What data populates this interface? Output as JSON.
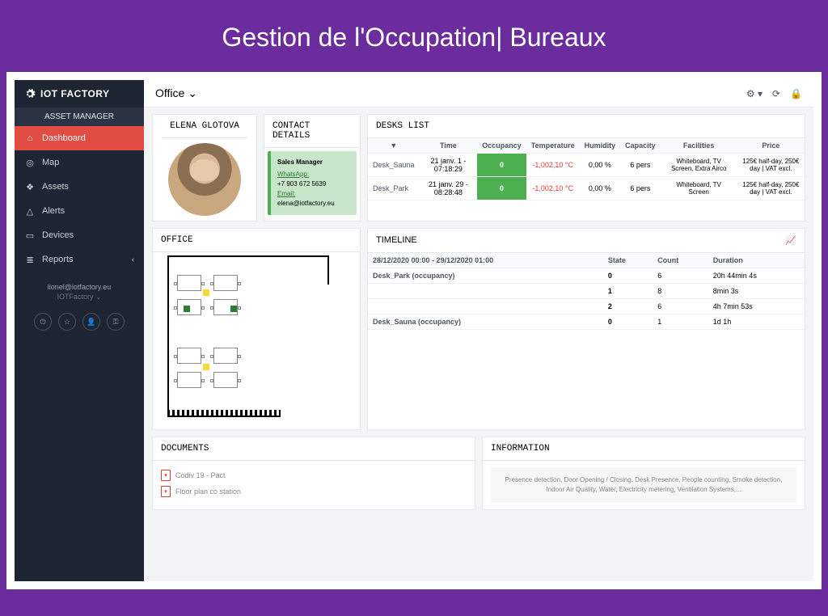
{
  "banner": "Gestion de l'Occupation| Bureaux",
  "brand": "IOT FACTORY",
  "section": "ASSET MANAGER",
  "nav": [
    {
      "label": "Dashboard",
      "active": true
    },
    {
      "label": "Map"
    },
    {
      "label": "Assets"
    },
    {
      "label": "Alerts"
    },
    {
      "label": "Devices"
    },
    {
      "label": "Reports",
      "caret": true
    }
  ],
  "user_email": "lionel@iotfactory.eu",
  "user_sub": "IOTFactory ⌄",
  "page_title": "Office ⌄",
  "profile": {
    "title": "ELENA GLOTOVA"
  },
  "contact": {
    "title": "CONTACT DETAILS",
    "role": "Sales Manager",
    "whatsapp_label": "WhatsApp:",
    "phone": "+7 903 672 5639",
    "email_label": "Email:",
    "email": "elena@iotfactory.eu"
  },
  "desks": {
    "title": "DESKS LIST",
    "headers": [
      "",
      "Time",
      "Occupancy",
      "Temperature",
      "Humidity",
      "Capacity",
      "Facilities",
      "Price"
    ],
    "rows": [
      {
        "name": "Desk_Sauna",
        "time": "21 janv. 1 - 07:18:29",
        "occ": "0",
        "temp": "-1,002,10 °C",
        "hum": "0,00 %",
        "cap": "6 pers",
        "fac": "Whiteboard, TV Screen, Extra Airco",
        "price": "125€ half-day, 250€ day | VAT excl."
      },
      {
        "name": "Desk_Park",
        "time": "21 janv. 29 - 08:28:48",
        "occ": "0",
        "temp": "-1,002,10 °C",
        "hum": "0,00 %",
        "cap": "6 pers",
        "fac": "Whiteboard, TV Screen",
        "price": "125€ half-day, 250€ day | VAT excl."
      }
    ]
  },
  "office": {
    "title": "OFFICE"
  },
  "timeline": {
    "title": "TIMELINE",
    "range": "28/12/2020 00:00 - 29/12/2020 01:00",
    "headers": [
      "",
      "State",
      "Count",
      "Duration"
    ],
    "groups": [
      {
        "label": "Desk_Park (occupancy)",
        "rows": [
          {
            "state": "0",
            "count": "6",
            "dur": "20h 44min 4s"
          },
          {
            "state": "1",
            "count": "8",
            "dur": "8min 3s"
          },
          {
            "state": "2",
            "count": "6",
            "dur": "4h 7min 53s"
          }
        ]
      },
      {
        "label": "Desk_Sauna (occupancy)",
        "rows": [
          {
            "state": "0",
            "count": "1",
            "dur": "1d 1h"
          }
        ]
      }
    ]
  },
  "documents": {
    "title": "DOCUMENTS",
    "items": [
      {
        "name": "Codiv 19 - Pact"
      },
      {
        "name": "Floor plan co station"
      }
    ]
  },
  "information": {
    "title": "INFORMATION",
    "text": "Presence detection, Door Opening / Closing, Desk Presence, People counting, Smoke detection, Indoor Air Quality, Water, Electricity metering, Ventilation Systems,..."
  }
}
